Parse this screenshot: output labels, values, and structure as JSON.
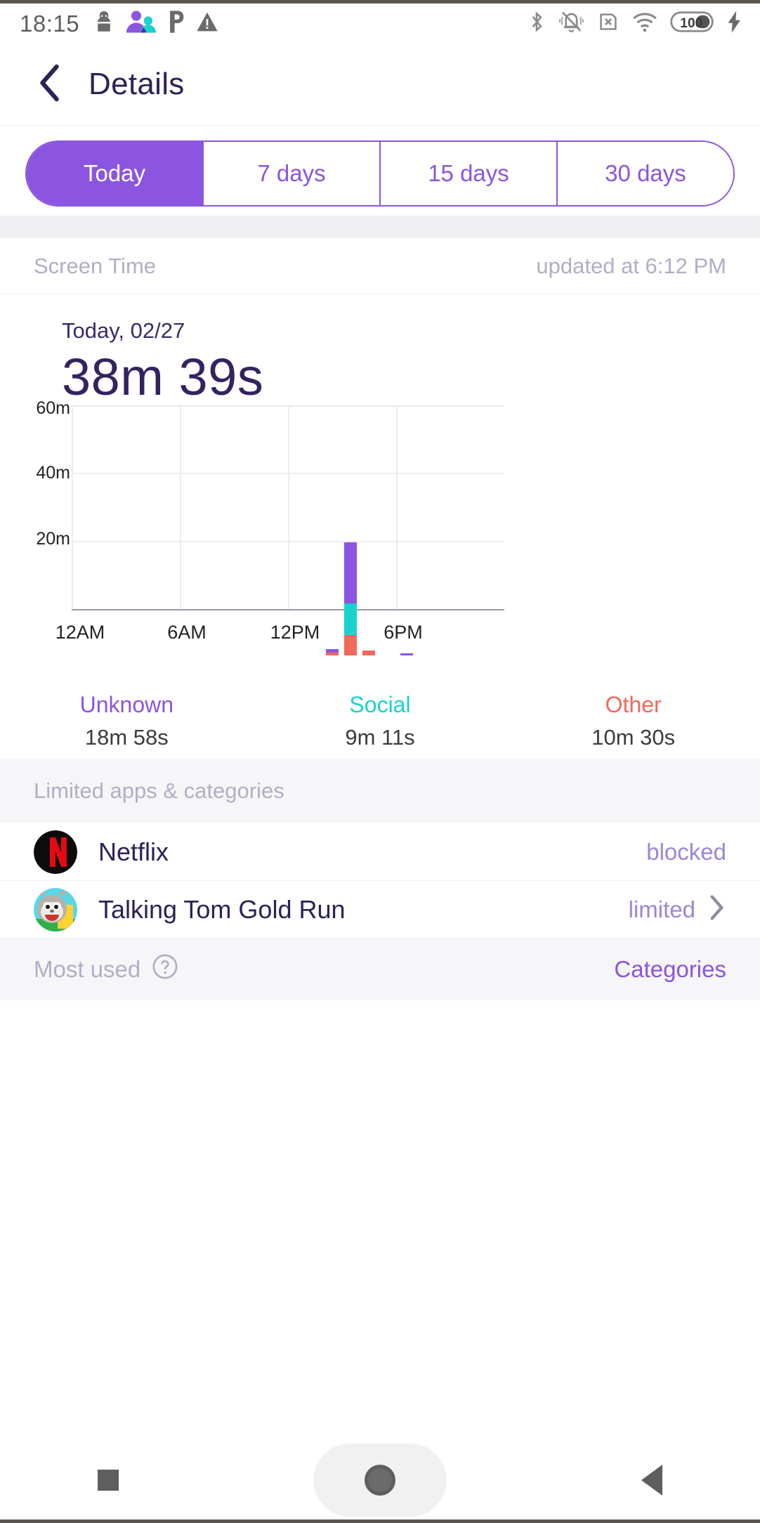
{
  "status_bar": {
    "time": "18:15",
    "left_icons": [
      "person-icon",
      "family-group-icon",
      "parking-p-icon",
      "warning-triangle-icon"
    ],
    "right_icons": [
      "bluetooth-icon",
      "vibrate-off-icon",
      "sim-card-error-icon",
      "wifi-icon",
      "battery-icon",
      "charging-bolt-icon"
    ],
    "battery_level": "100"
  },
  "app_bar": {
    "back_icon": "chevron-left-icon",
    "title": "Details"
  },
  "tabs": {
    "items": [
      {
        "label": "Today",
        "active": true
      },
      {
        "label": "7 days",
        "active": false
      },
      {
        "label": "15 days",
        "active": false
      },
      {
        "label": "30 days",
        "active": false
      }
    ],
    "accent_color": "#8b55e0"
  },
  "screen_time_header": {
    "title": "Screen Time",
    "updated": "updated at 6:12 PM"
  },
  "summary": {
    "date": "Today, 02/27",
    "total": "38m 39s"
  },
  "legend": [
    {
      "name": "Unknown",
      "value": "18m 58s",
      "color": "#8b55e0"
    },
    {
      "name": "Social",
      "value": "9m 11s",
      "color": "#19d3ce"
    },
    {
      "name": "Other",
      "value": "10m 30s",
      "color": "#f2685c"
    }
  ],
  "limited_section": {
    "header": "Limited apps & categories",
    "rows": [
      {
        "icon": "netflix-icon",
        "name": "Netflix",
        "status": "blocked",
        "chevron": false
      },
      {
        "icon": "talking-tom-icon",
        "name": "Talking Tom Gold Run",
        "status": "limited",
        "chevron": true
      }
    ]
  },
  "most_used_footer": {
    "label": "Most used",
    "help_icon": "question-circle-icon",
    "action": "Categories"
  },
  "nav_bar": {
    "recents": "square-recents-icon",
    "home": "circle-home-icon",
    "back": "triangle-back-icon"
  },
  "chart_data": {
    "type": "bar",
    "title": "Screen Time",
    "stacked": true,
    "xlabel": "",
    "ylabel": "",
    "ylim": [
      0,
      60
    ],
    "yticks": [
      "20m",
      "40m",
      "60m"
    ],
    "ytick_values": [
      20,
      40,
      60
    ],
    "xticks": [
      "12AM",
      "6AM",
      "12PM",
      "6PM"
    ],
    "xtick_hours": [
      0,
      6,
      12,
      18
    ],
    "x_range_hours": [
      0,
      24
    ],
    "grid": true,
    "legend_position": "below",
    "series": [
      {
        "name": "Other",
        "color": "#f2685c",
        "values_by_hour": {
          "13": 0.7,
          "14": 6.0,
          "15": 1.4
        }
      },
      {
        "name": "Social",
        "color": "#19d3ce",
        "values_by_hour": {
          "14": 9.2
        }
      },
      {
        "name": "Unknown",
        "color": "#8b55e0",
        "values_by_hour": {
          "13": 1.1,
          "14": 18.0,
          "18": 0.5
        }
      }
    ],
    "bars": [
      {
        "hour": 13,
        "segments": [
          {
            "name": "Other",
            "value": 0.7
          },
          {
            "name": "Unknown",
            "value": 1.1
          }
        ]
      },
      {
        "hour": 14,
        "segments": [
          {
            "name": "Other",
            "value": 6.0
          },
          {
            "name": "Social",
            "value": 9.2
          },
          {
            "name": "Unknown",
            "value": 18.0
          }
        ]
      },
      {
        "hour": 15,
        "segments": [
          {
            "name": "Other",
            "value": 1.4
          }
        ]
      },
      {
        "hour": 18,
        "segments": [
          {
            "name": "Unknown",
            "value": 0.5
          }
        ]
      }
    ]
  }
}
